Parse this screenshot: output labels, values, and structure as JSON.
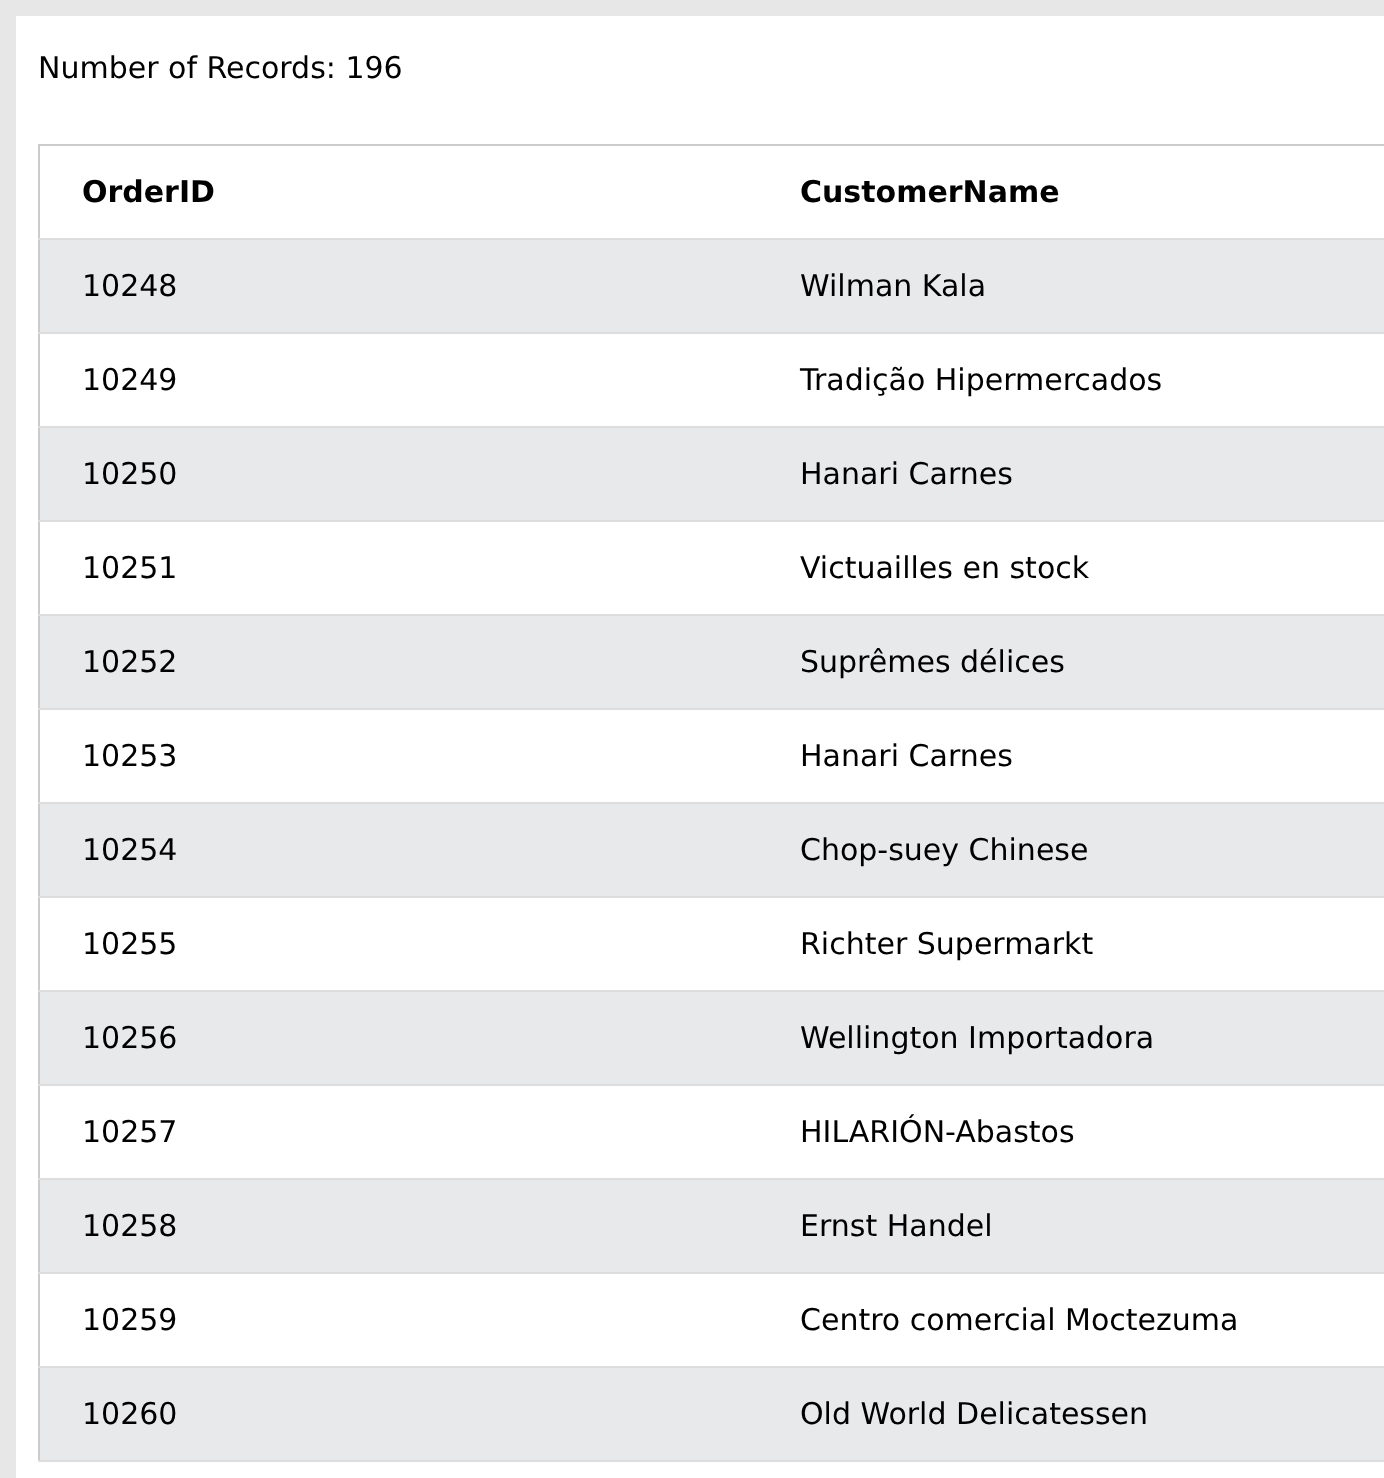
{
  "record_count": "Number of Records: 196",
  "table": {
    "columns": [
      "OrderID",
      "CustomerName"
    ],
    "rows": [
      [
        "10248",
        "Wilman Kala"
      ],
      [
        "10249",
        "Tradição Hipermercados"
      ],
      [
        "10250",
        "Hanari Carnes"
      ],
      [
        "10251",
        "Victuailles en stock"
      ],
      [
        "10252",
        "Suprêmes délices"
      ],
      [
        "10253",
        "Hanari Carnes"
      ],
      [
        "10254",
        "Chop-suey Chinese"
      ],
      [
        "10255",
        "Richter Supermarkt"
      ],
      [
        "10256",
        "Wellington Importadora"
      ],
      [
        "10257",
        "HILARIÓN-Abastos"
      ],
      [
        "10258",
        "Ernst Handel"
      ],
      [
        "10259",
        "Centro comercial Moctezuma"
      ],
      [
        "10260",
        "Old World Delicatessen"
      ]
    ]
  }
}
